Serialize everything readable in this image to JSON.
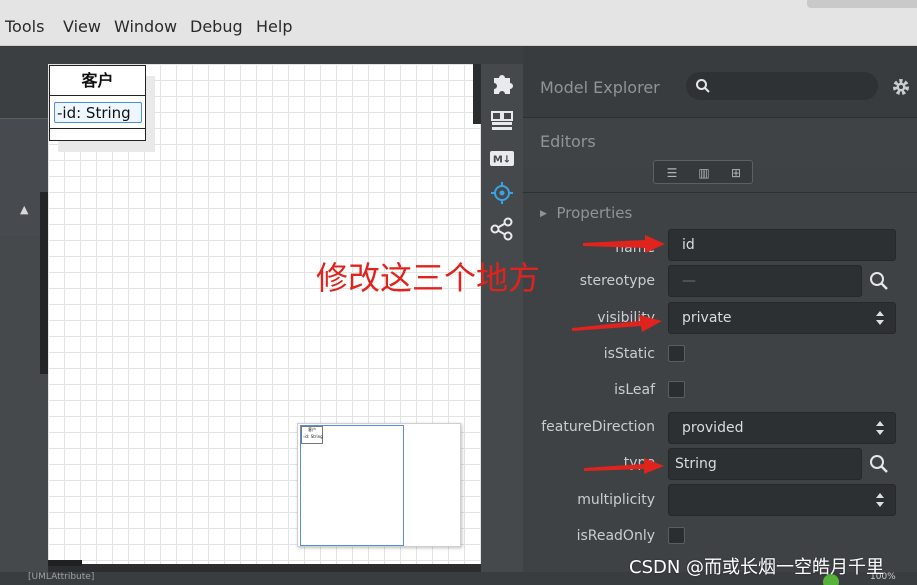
{
  "menu": [
    "Tools",
    "View",
    "Window",
    "Debug",
    "Help"
  ],
  "diagram": {
    "class_name": "客户",
    "attribute": "-id: String",
    "minimap_class_name": "客户",
    "minimap_attribute": "-id: String"
  },
  "toolbar": {
    "icons": [
      "puzzle-icon",
      "layout-icon",
      "markdown-icon",
      "crosshair-icon",
      "share-icon"
    ],
    "md_label": "M↓"
  },
  "model_explorer": {
    "title": "Model Explorer",
    "search_placeholder": ""
  },
  "editors": {
    "title": "Editors"
  },
  "properties": {
    "header": "Properties",
    "fields": {
      "name": {
        "label": "name",
        "value": "id"
      },
      "stereotype": {
        "label": "stereotype",
        "value": "—"
      },
      "visibility": {
        "label": "visibility",
        "value": "private"
      },
      "isStatic": {
        "label": "isStatic",
        "checked": false
      },
      "isLeaf": {
        "label": "isLeaf",
        "checked": false
      },
      "featureDirection": {
        "label": "featureDirection",
        "value": "provided"
      },
      "type": {
        "label": "type",
        "value": "String"
      },
      "multiplicity": {
        "label": "multiplicity",
        "value": ""
      },
      "isReadOnly": {
        "label": "isReadOnly",
        "checked": false
      }
    }
  },
  "annotation": {
    "text": "修改这三个地方",
    "color": "#e0231c"
  },
  "watermark": "CSDN @而或长烟一空皓月千里",
  "status": {
    "left_text": "[UMLAttribute]",
    "zoom": "100%"
  }
}
